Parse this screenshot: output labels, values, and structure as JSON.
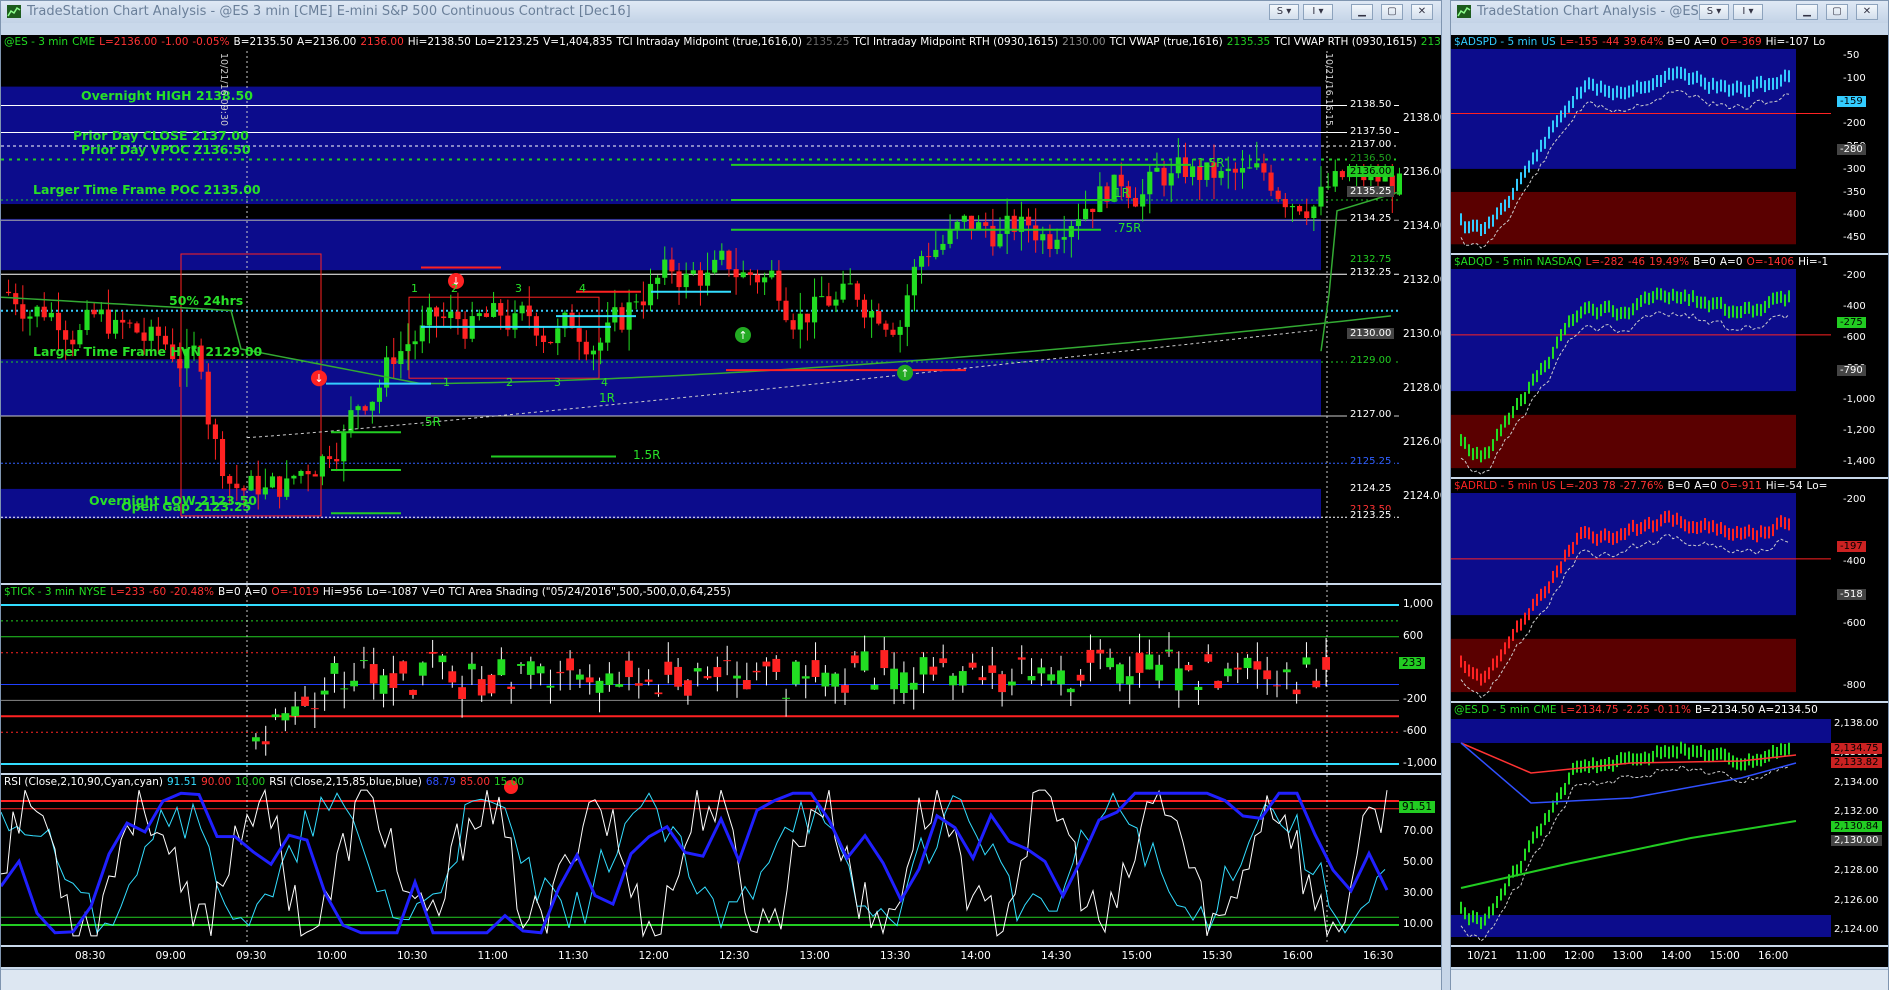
{
  "main_window": {
    "title": "TradeStation Chart Analysis - @ES 3 min [CME] E-mini S&P 500 Continuous Contract [Dec16]",
    "buttons": [
      "S",
      "I"
    ],
    "price_panel": {
      "symbol": "@ES - 3 min",
      "exchange": "CME",
      "last": "L=2136.00",
      "change": "-1.00",
      "change_pct": "-0.05%",
      "bid": "B=2135.50",
      "ask": "A=2136.00",
      "open": "2136.00",
      "high": "Hi=2138.50",
      "low": "Lo=2123.25",
      "volume": "V=1,404,835",
      "study1": "TCI Intraday Midpoint (true,1616,0)",
      "study1_val": "2135.25",
      "study2": "TCI Intraday Midpoint RTH (0930,1615)",
      "study2_val": "2130.00",
      "study3": "TCI VWAP (true,1616)",
      "study3_val": "2135.35",
      "study4": "TCI VWAP RTH (0930,1615)",
      "study4_val": "213",
      "date_marker_1": "10/21/16 09:30",
      "date_marker_2": "10/21/16 16:15",
      "levels": [
        {
          "label": "Overnight HIGH 2138.50",
          "price": 2138.5
        },
        {
          "label": "Prior Day CLOSE 2137.00",
          "price": 2137.0
        },
        {
          "label": "Prior Day VPOC 2136.50",
          "price": 2136.5
        },
        {
          "label": "Larger Time Frame POC 2135.00",
          "price": 2135.0
        },
        {
          "label": "50% 24hrs",
          "price": 2130.9
        },
        {
          "label": "Larger Time Frame HVN 2129.00",
          "price": 2129.0
        },
        {
          "label": "Overnight LOW 2123.50",
          "price": 2123.5
        },
        {
          "label": "Open Gap 2123.25",
          "price": 2123.25
        }
      ],
      "target_labels": [
        "1.5R",
        "1R",
        ".75R",
        "1R",
        ".5R",
        "1.5R"
      ],
      "count_labels": [
        "1",
        "2",
        "3",
        "4",
        "1",
        "2",
        "3",
        "4"
      ],
      "y_ticks": [
        "2138.00",
        "2136.00",
        "2134.00",
        "2132.00",
        "2130.00",
        "2128.00",
        "2126.00",
        "2124.00"
      ],
      "price_tags": [
        {
          "text": "2138.50",
          "price": 2138.5,
          "bg": "#000000",
          "fg": "#ffffff"
        },
        {
          "text": "2137.50",
          "price": 2137.5,
          "bg": "#000000",
          "fg": "#ffffff"
        },
        {
          "text": "2137.00",
          "price": 2137.0,
          "bg": "#000000",
          "fg": "#ffffff"
        },
        {
          "text": "2136.50",
          "price": 2136.5,
          "bg": "#000000",
          "fg": "#1fa01f"
        },
        {
          "text": "2136.00",
          "price": 2136.0,
          "bg": "#22cc22",
          "fg": "#000000"
        },
        {
          "text": "2135.25",
          "price": 2135.25,
          "bg": "#444444",
          "fg": "#ffffff"
        },
        {
          "text": "2134.25",
          "price": 2134.25,
          "bg": "#000000",
          "fg": "#ffffff"
        },
        {
          "text": "2132.75",
          "price": 2132.75,
          "bg": "#000000",
          "fg": "#22cc22"
        },
        {
          "text": "2132.25",
          "price": 2132.25,
          "bg": "#000000",
          "fg": "#ffffff"
        },
        {
          "text": "2130.00",
          "price": 2130.0,
          "bg": "#444444",
          "fg": "#ffffff"
        },
        {
          "text": "2129.00",
          "price": 2129.0,
          "bg": "#000000",
          "fg": "#22cc22"
        },
        {
          "text": "2127.00",
          "price": 2127.0,
          "bg": "#000000",
          "fg": "#ffffff"
        },
        {
          "text": "2125.25",
          "price": 2125.25,
          "bg": "#000000",
          "fg": "#3060ff"
        },
        {
          "text": "2124.25",
          "price": 2124.25,
          "bg": "#000000",
          "fg": "#ffffff"
        },
        {
          "text": "2123.50",
          "price": 2123.5,
          "bg": "#000000",
          "fg": "#ff3333"
        },
        {
          "text": "2123.25",
          "price": 2123.25,
          "bg": "#000000",
          "fg": "#ffffff"
        }
      ]
    },
    "tick_panel": {
      "symbol": "$TICK - 3 min",
      "exchange": "NYSE",
      "last": "L=233",
      "change": "-60",
      "change_pct": "-20.48%",
      "bid": "B=0",
      "ask": "A=0",
      "open": "O=-1019",
      "high": "Hi=956",
      "low": "Lo=-1087",
      "volume": "V=0",
      "study": "TCI Area Shading (\"05/24/2016\",500,-500,0,0,64,255)",
      "y_ticks": [
        "1,000",
        "600",
        "-200",
        "-600",
        "-1,000"
      ],
      "last_tag": "233"
    },
    "rsi_panel": {
      "study1": "RSI (Close,2,10,90,Cyan,cyan)",
      "study1_vals": [
        "91.51",
        "90.00",
        "10.00"
      ],
      "study2": "RSI (Close,2,15,85,blue,blue)",
      "study2_vals": [
        "68.79",
        "85.00",
        "15.00"
      ],
      "y_ticks": [
        "70.00",
        "50.00",
        "30.00",
        "10.00"
      ],
      "last_tag": "91.51"
    },
    "time_ticks": [
      "08:30",
      "09:00",
      "09:30",
      "10:00",
      "10:30",
      "11:00",
      "11:30",
      "12:00",
      "12:30",
      "13:00",
      "13:30",
      "14:00",
      "14:30",
      "15:00",
      "15:30",
      "16:00",
      "16:30"
    ]
  },
  "side_window": {
    "title": "TradeStation Chart Analysis - @ES.D ...",
    "buttons": [
      "S",
      "I"
    ],
    "panels": [
      {
        "symbol": "$ADSPD - 5 min",
        "exchange": "US",
        "last": "L=-155",
        "change": "-44",
        "change_pct": "39.64%",
        "bid": "B=0",
        "ask": "A=0",
        "open": "O=-369",
        "high": "Hi=-107",
        "tail": "Lo",
        "y_ticks": [
          "-50",
          "-100",
          "-150",
          "-200",
          "-250",
          "-300",
          "-350",
          "-400",
          "-450"
        ],
        "tags": [
          {
            "text": "-159",
            "bg": "#33ccff",
            "fg": "#000000"
          },
          {
            "text": "-280",
            "bg": "#444444",
            "fg": "#ffffff"
          }
        ]
      },
      {
        "symbol": "$ADQD - 5 min",
        "exchange": "NASDAQ",
        "last": "L=-282",
        "change": "-46",
        "change_pct": "19.49%",
        "bid": "B=0",
        "ask": "A=0",
        "open": "O=-1406",
        "high": "Hi=-1",
        "tail": "",
        "y_ticks": [
          "-200",
          "-400",
          "-600",
          "-800",
          "-1,000",
          "-1,200",
          "-1,400"
        ],
        "tags": [
          {
            "text": "-275",
            "bg": "#22cc22",
            "fg": "#000000"
          },
          {
            "text": "-790",
            "bg": "#444444",
            "fg": "#ffffff"
          }
        ]
      },
      {
        "symbol": "$ADRLD - 5 min",
        "exchange": "US",
        "last": "L=-203",
        "change": "78",
        "change_pct": "-27.76%",
        "bid": "B=0",
        "ask": "A=0",
        "open": "O=-911",
        "high": "Hi=-54",
        "tail": "Lo=",
        "y_ticks": [
          "-200",
          "-400",
          "-600",
          "-800"
        ],
        "tags": [
          {
            "text": "-197",
            "bg": "#cc2222",
            "fg": "#000000"
          },
          {
            "text": "-518",
            "bg": "#444444",
            "fg": "#ffffff"
          }
        ]
      },
      {
        "symbol": "@ES.D - 5 min",
        "exchange": "CME",
        "last": "L=2134.75",
        "change": "-2.25",
        "change_pct": "-0.11%",
        "bid": "B=2134.50",
        "ask": "A=2134.50",
        "open": "",
        "high": "",
        "tail": "",
        "y_ticks": [
          "2,138.00",
          "2,136.00",
          "2,134.00",
          "2,132.00",
          "2,130.00",
          "2,128.00",
          "2,126.00",
          "2,124.00"
        ],
        "tags": [
          {
            "text": "2,134.75",
            "bg": "#cc2222",
            "fg": "#000000"
          },
          {
            "text": "2,133.82",
            "bg": "#cc2222",
            "fg": "#000000"
          },
          {
            "text": "2,130.84",
            "bg": "#22cc22",
            "fg": "#000000"
          },
          {
            "text": "2,130.00",
            "bg": "#444444",
            "fg": "#ffffff"
          }
        ]
      }
    ],
    "time_ticks": [
      "10/21",
      "11:00",
      "12:00",
      "13:00",
      "14:00",
      "15:00",
      "16:00"
    ]
  },
  "colors": {
    "up": "#22dd22",
    "down": "#ff2222",
    "zone": "#0c0c8c",
    "level_text": "#28e028",
    "cyan": "#33ddff",
    "rsi_blue": "#2020ff"
  }
}
